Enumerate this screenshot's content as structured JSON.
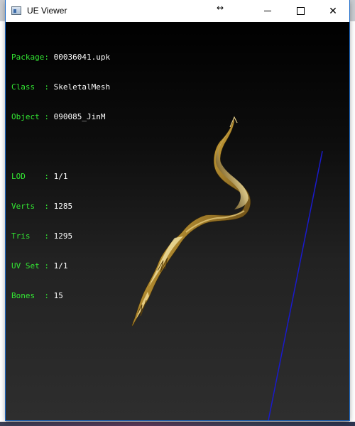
{
  "window": {
    "title": "UE Viewer",
    "controls": {
      "minimize": "minimize",
      "maximize": "maximize",
      "close": "✕"
    }
  },
  "info_block": {
    "package": {
      "key": "Package: ",
      "value": "00036041.upk"
    },
    "class": {
      "key": "Class  : ",
      "value": "SkeletalMesh"
    },
    "object": {
      "key": "Object : ",
      "value": "090085_JinM"
    },
    "lod": {
      "key": "LOD    : ",
      "value": "1/1"
    },
    "verts": {
      "key": "Verts  : ",
      "value": "1285"
    },
    "tris": {
      "key": "Tris   : ",
      "value": "1295"
    },
    "uvset": {
      "key": "UV Set : ",
      "value": "1/1"
    },
    "bones": {
      "key": "Bones  : ",
      "value": "15"
    }
  },
  "colors": {
    "label": "#33e633",
    "value": "#ffffff",
    "axis_line": "#1a1acc",
    "mesh": "#c9a545"
  }
}
